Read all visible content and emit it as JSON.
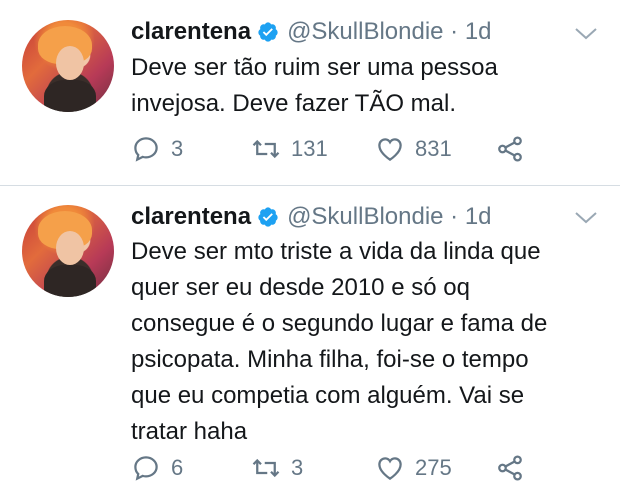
{
  "colors": {
    "accent": "#1da1f2",
    "text": "#14171a",
    "muted": "#657786"
  },
  "tweets": [
    {
      "name": "clarentena",
      "handle": "@SkullBlondie · 1d",
      "verified": true,
      "lines": [
        "Deve ser tão ruim ser uma pessoa",
        "invejosa. Deve fazer TÃO mal."
      ],
      "replies": "3",
      "retweets": "131",
      "likes": "831"
    },
    {
      "name": "clarentena",
      "handle": "@SkullBlondie · 1d",
      "verified": true,
      "lines": [
        "Deve ser mto triste a vida da linda que",
        "quer ser eu desde 2010 e só oq",
        "consegue é o segundo lugar e fama de",
        "psicopata. Minha filha, foi-se o tempo",
        "que eu competia com alguém. Vai se",
        "tratar haha"
      ],
      "replies": "6",
      "retweets": "3",
      "likes": "275"
    }
  ],
  "icons": {
    "avatar": "avatar",
    "verified": "verified-badge-icon",
    "caret": "chevron-down-icon",
    "reply": "reply-icon",
    "retweet": "retweet-icon",
    "like": "heart-icon",
    "share": "share-icon"
  }
}
